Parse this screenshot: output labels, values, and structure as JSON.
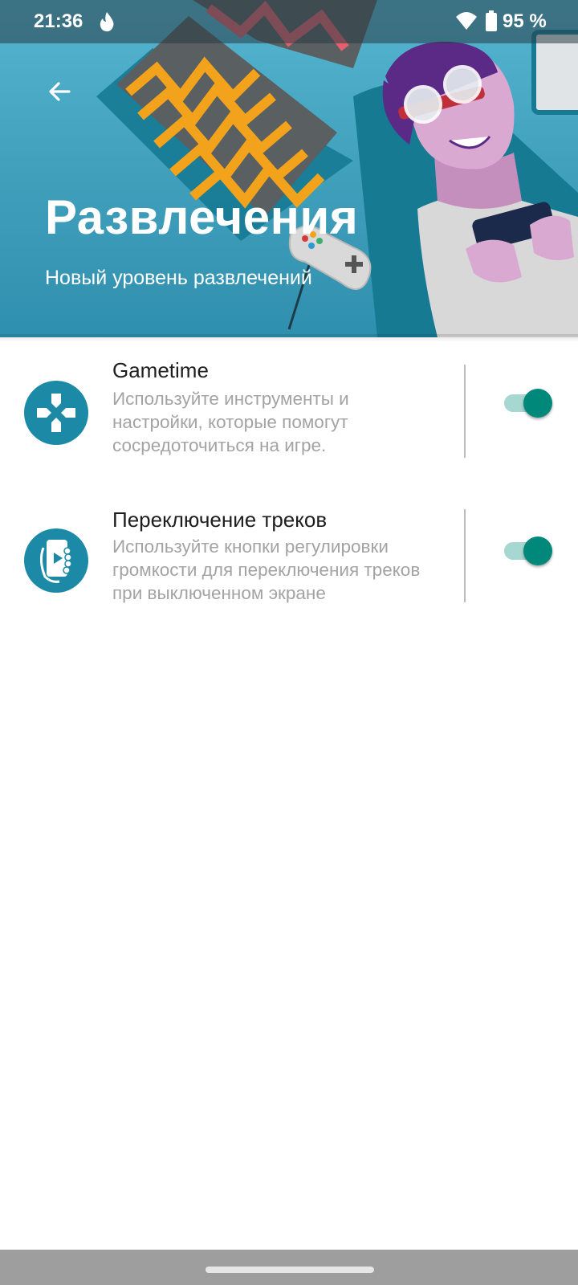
{
  "status_bar": {
    "time": "21:36",
    "battery_text": "95 %",
    "icons": [
      "flame-icon",
      "wifi-icon",
      "battery-icon"
    ]
  },
  "header": {
    "title": "Развлечения",
    "subtitle": "Новый уровень развлечений",
    "back_icon": "arrow-left-icon"
  },
  "items": [
    {
      "title": "Gametime",
      "description": "Используйте инструменты и настройки, которые помогут сосредоточиться на игре.",
      "icon": "gamepad-icon",
      "enabled": true
    },
    {
      "title": "Переключение треков",
      "description": "Используйте кнопки регулировки громкости для переключения треков при выключенном экране",
      "icon": "phone-hand-play-icon",
      "enabled": true
    }
  ],
  "colors": {
    "header_bg": "#4aaac6",
    "icon_bg": "#1c8aa6",
    "switch_thumb": "#00897b",
    "switch_track": "#a6d7d1",
    "nav_bar": "#9e9e9e"
  }
}
